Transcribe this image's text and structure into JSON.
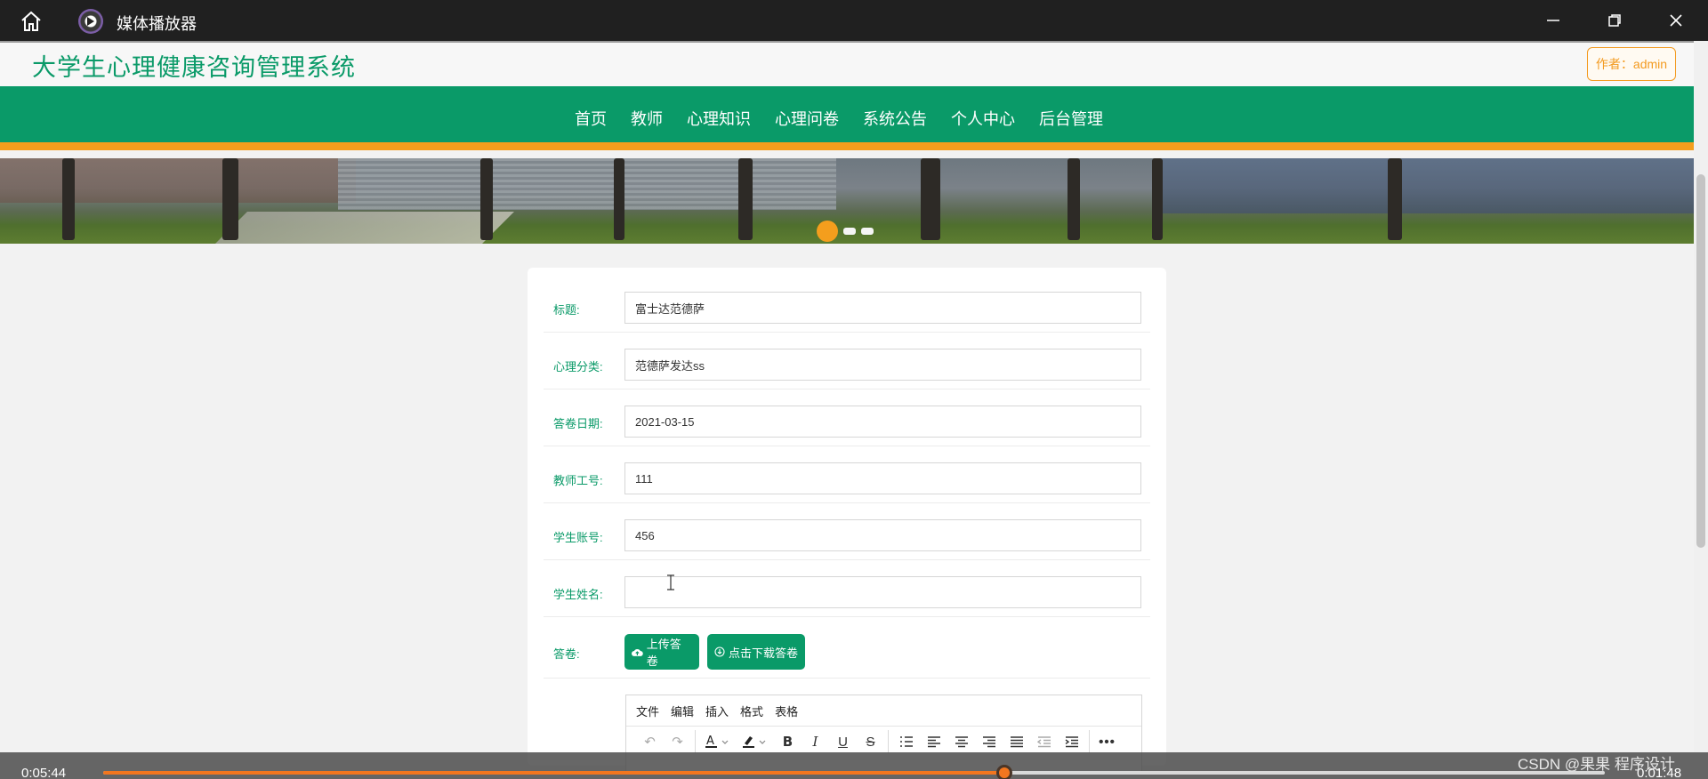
{
  "player": {
    "title": "媒体播放器",
    "time_elapsed": "0:05:44",
    "time_remaining": "0:01:48",
    "progress_fraction": 0.6,
    "accent_color": "#f2761f"
  },
  "site": {
    "title": "大学生心理健康咨询管理系统",
    "author_label": "作者：admin",
    "nav": [
      "首页",
      "教师",
      "心理知识",
      "心理问卷",
      "系统公告",
      "个人中心",
      "后台管理"
    ],
    "brand_color": "#0a9a68",
    "accent_color": "#f49e1d"
  },
  "form": {
    "fields": [
      {
        "label": "标题:",
        "value": "富士达范德萨"
      },
      {
        "label": "心理分类:",
        "value": "范德萨发达ss"
      },
      {
        "label": "答卷日期:",
        "value": "2021-03-15"
      },
      {
        "label": "教师工号:",
        "value": "111"
      },
      {
        "label": "学生账号:",
        "value": "456"
      },
      {
        "label": "学生姓名:",
        "value": ""
      }
    ],
    "answer_label": "答卷:",
    "upload_button": "上传答卷",
    "download_button": "点击下载答卷"
  },
  "editor": {
    "menu": [
      "文件",
      "编辑",
      "插入",
      "格式",
      "表格"
    ]
  },
  "watermark": "CSDN @果果 程序设计"
}
